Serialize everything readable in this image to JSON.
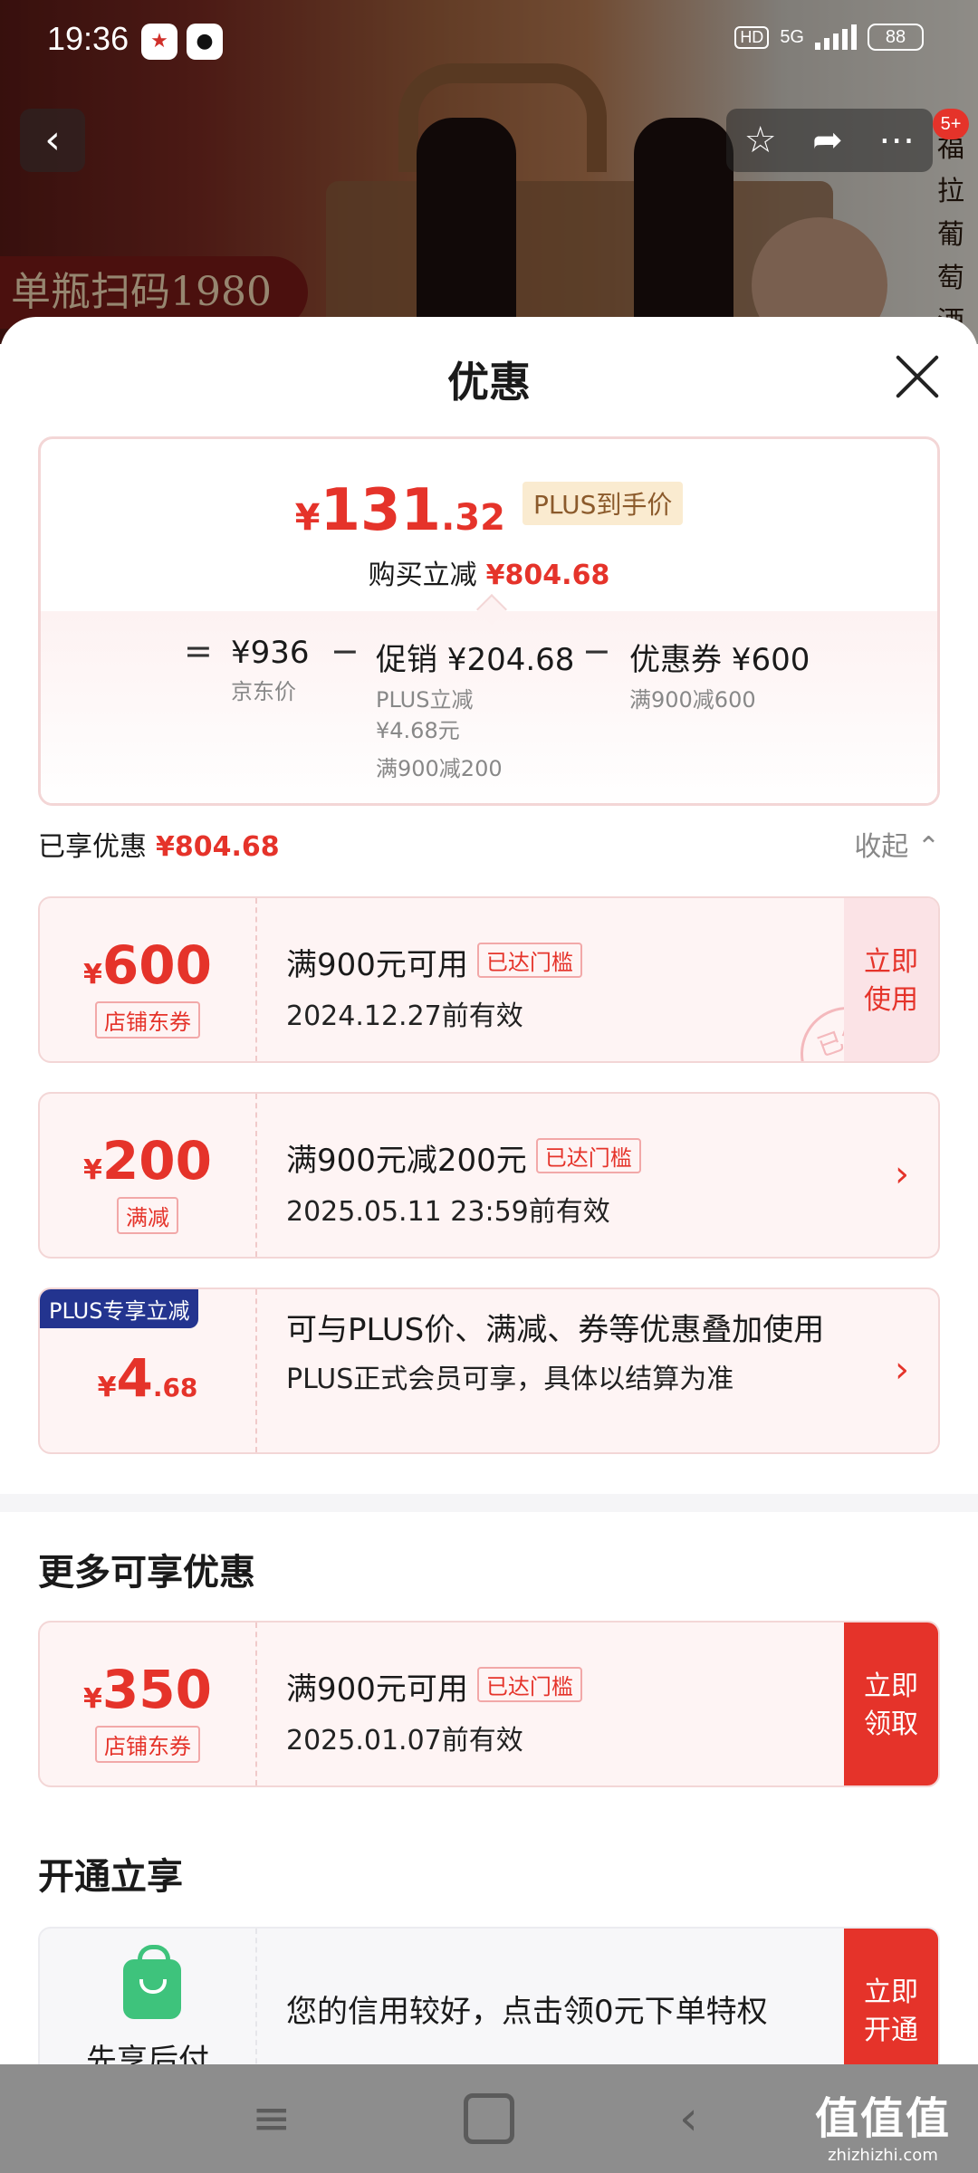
{
  "status_bar": {
    "time": "19:36",
    "hd": "HD",
    "network": "5G",
    "battery": "88"
  },
  "product_bg": {
    "promo_text": "单瓶扫码1980",
    "side_text": "福拉葡萄酒品"
  },
  "nav": {
    "badge": "5+"
  },
  "sheet": {
    "title": "优惠",
    "summary": {
      "currency": "¥",
      "price_int": "131",
      "price_dec": ".32",
      "plus_label": "PLUS到手价",
      "reduce_label": "购买立减",
      "reduce_amount": "¥804.68",
      "eq": "=",
      "jd_price": "¥936",
      "jd_label": "京东价",
      "minus": "−",
      "promo": "促销 ¥204.68",
      "promo_sub1": "PLUS立减",
      "promo_sub2": "¥4.68元",
      "promo_sub3": "满900减200",
      "coupon": "优惠券 ¥600",
      "coupon_sub": "满900减600"
    },
    "enjoyed": {
      "label": "已享优惠",
      "amount": "¥804.68",
      "collapse": "收起 ⌃"
    },
    "coupons": [
      {
        "yen": "¥",
        "amount": "600",
        "tag": "店铺东券",
        "title": "满900元可用",
        "reach": "已达门槛",
        "valid": "2024.12.27前有效",
        "action": "立即使用",
        "stamp": "已领"
      },
      {
        "yen": "¥",
        "amount": "200",
        "tag": "满减",
        "title": "满900元减200元",
        "reach": "已达门槛",
        "valid": "2025.05.11 23:59前有效",
        "arrow": "›"
      },
      {
        "flag": "PLUS专享立减",
        "yen": "¥",
        "amount": "4",
        "decimal": ".68",
        "title": "可与PLUS价、满减、券等优惠叠加使用",
        "valid": "PLUS正式会员可享，具体以结算为准",
        "arrow": "›"
      }
    ],
    "more": {
      "title": "更多可享优惠",
      "coupon": {
        "yen": "¥",
        "amount": "350",
        "tag": "店铺东券",
        "title": "满900元可用",
        "reach": "已达门槛",
        "valid": "2025.01.07前有效",
        "action": "立即领取"
      }
    },
    "open": {
      "title": "开通立享",
      "card": {
        "label": "先享后付",
        "text": "您的信用较好，点击领0元下单特权",
        "action": "立即开通"
      }
    }
  },
  "navbar": {
    "watermark": "值值值",
    "watermark_url": "zhizhizhi.com"
  }
}
